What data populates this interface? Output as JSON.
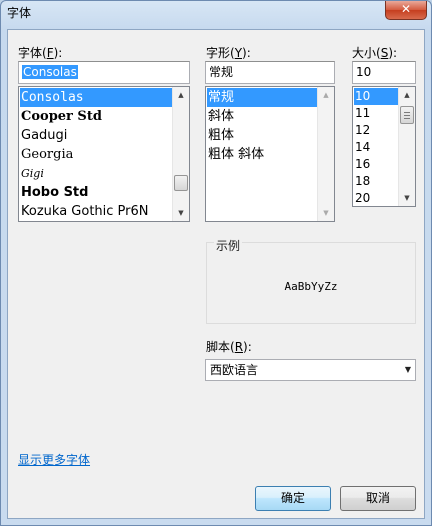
{
  "window": {
    "title": "字体",
    "close_glyph": "✕"
  },
  "font": {
    "label_prefix": "字体(",
    "label_key": "F",
    "label_suffix": "):",
    "value": "Consolas",
    "items": [
      "Consolas",
      "Cooper Std",
      "Gadugi",
      "Georgia",
      "Gigi",
      "Hobo Std",
      "Kozuka Gothic Pr6N"
    ],
    "selected_index": 0
  },
  "style": {
    "label_prefix": "字形(",
    "label_key": "Y",
    "label_suffix": "):",
    "value": "常规",
    "items": [
      "常规",
      "斜体",
      "粗体",
      "粗体 斜体"
    ],
    "selected_index": 0
  },
  "size": {
    "label_prefix": "大小(",
    "label_key": "S",
    "label_suffix": "):",
    "value": "10",
    "items": [
      "10",
      "11",
      "12",
      "14",
      "16",
      "18",
      "20"
    ],
    "selected_index": 0
  },
  "sample": {
    "label": "示例",
    "text": "AaBbYyZz"
  },
  "script": {
    "label_prefix": "脚本(",
    "label_key": "R",
    "label_suffix": "):",
    "value": "西欧语言"
  },
  "more_fonts_link": "显示更多字体",
  "buttons": {
    "ok": "确定",
    "cancel": "取消"
  },
  "colors": {
    "selection": "#3399ff",
    "link": "#0066cc"
  }
}
